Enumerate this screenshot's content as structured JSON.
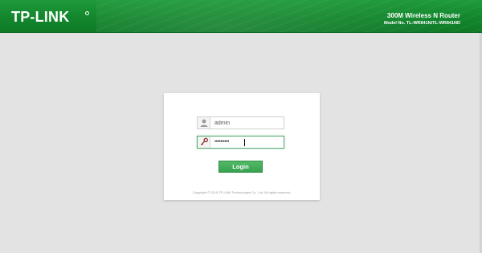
{
  "header": {
    "logo_text": "TP-LINK",
    "product_title": "300M Wireless N Router",
    "model_number": "Model No. TL-WR841N/TL-WR841ND",
    "background_color": "#13862d"
  },
  "login": {
    "username_value": "admin",
    "username_icon": "user-icon",
    "password_value": "••••••••••",
    "password_icon": "key-icon",
    "login_label": "Login",
    "accent_color": "#37a24f"
  },
  "footer": {
    "copyright": "Copyright © 2015 TP-LINK Technologies Co., Ltd. All rights reserved."
  }
}
